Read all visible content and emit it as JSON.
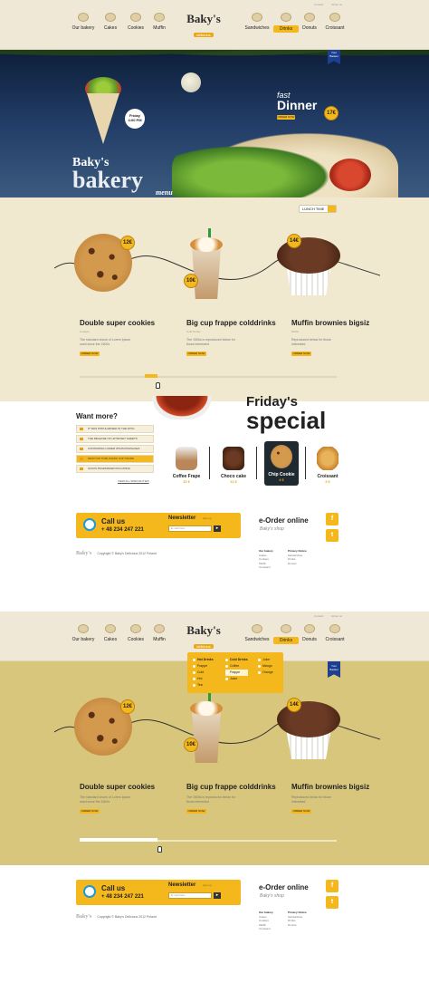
{
  "header": {
    "top_links": [
      "Contact",
      "About us"
    ],
    "logo_name": "Baky's",
    "logo_sub": "delicious",
    "nav": [
      {
        "label": "Our bakery",
        "icon": "bakery-icon"
      },
      {
        "label": "Cakes",
        "icon": "cake-icon"
      },
      {
        "label": "Cookies",
        "icon": "cookie-icon"
      },
      {
        "label": "Muffin",
        "icon": "muffin-icon"
      },
      {
        "label": "Sandwiches",
        "icon": "sandwich-icon"
      },
      {
        "label": "Drinks",
        "icon": "drink-icon",
        "active": true
      },
      {
        "label": "Donuts",
        "icon": "donut-icon"
      },
      {
        "label": "Croissant",
        "icon": "croissant-icon"
      }
    ]
  },
  "hero": {
    "badge_line1": "Friday",
    "badge_line2": "4:00 PM",
    "fast": "fast",
    "dinner": "Dinner",
    "order_now": "ORDER NOW",
    "price": "17€",
    "ribbon": "Your Basket",
    "title_small": "Baky's",
    "title_big": "bakery",
    "title_menu": "menu"
  },
  "products": {
    "lunchbox": "LUNCH TIME",
    "items": [
      {
        "title": "Double super cookies",
        "sub": "Cookies",
        "desc": "The standard chunk of Lorem Ipsum used since the 1500s",
        "order": "ORDER NOW",
        "price": "12€"
      },
      {
        "title": "Big cup frappe colddrinks",
        "sub": "Cold Drinks",
        "desc": "The 1500s is reproduced below for those interested",
        "order": "ORDER NOW",
        "price": "10€"
      },
      {
        "title": "Muffin brownies bigsiz",
        "sub": "Muffin",
        "desc": "Reproduced below for those interested",
        "order": "ORDER NOW",
        "price": "14€"
      }
    ]
  },
  "special": {
    "want_more": "Want more?",
    "list": [
      "IT WAS POPULARISED IN THE WITH",
      "THE RELEASE OF LETRASET SHEETS",
      "CONTAINING LOREM IPSUM PASSAGES",
      "DESKTOP PUBLISHING SOFTWARE",
      "ALDUS PAGEMAKER INCLUDING"
    ],
    "view_all": "VIEW ALL SPECIALITIES",
    "title_a": "Friday's",
    "title_b": "special",
    "cards": [
      {
        "name": "Coffee Frape",
        "price": "10 €",
        "color": "#b9875a"
      },
      {
        "name": "Choco cake",
        "price": "12 €",
        "color": "#4a2818"
      },
      {
        "name": "Chip Cookie",
        "price": "4 €",
        "color": "#d39a4e"
      },
      {
        "name": "Croissant",
        "price": "3 €",
        "color": "#e3a54a"
      }
    ]
  },
  "footer": {
    "call_us": "Call us",
    "phone": "+ 48 234 247 221",
    "newsletter": "Newsletter",
    "signup": "sign up",
    "email_placeholder": "E-mail here",
    "go": "▸",
    "eorder": "e-Order online",
    "eorder_sub": "Baky's shop",
    "copyright": "Copyright © Baky's Delicious 2012 Poland",
    "col1": {
      "head": "Our bakery",
      "items": [
        "Cakes",
        "Cookies",
        "Muffin",
        "Croissant"
      ]
    },
    "col2": {
      "head": "Privacy Notice",
      "items": [
        "Sandwiches",
        "Drinks",
        "Donuts"
      ]
    }
  },
  "dropdown": {
    "col1": [
      "Hot Drinks",
      "Frappe",
      "Cold",
      "Hot",
      "Tea"
    ],
    "col2": [
      "Cold Drinks",
      "Coffee",
      "Frappe",
      "Juice"
    ],
    "col3": [
      "Juice",
      "Mango",
      "Orange"
    ]
  },
  "colors": {
    "accent": "#f5b81c",
    "cream": "#f1e9cf",
    "night": "#1c3258"
  }
}
